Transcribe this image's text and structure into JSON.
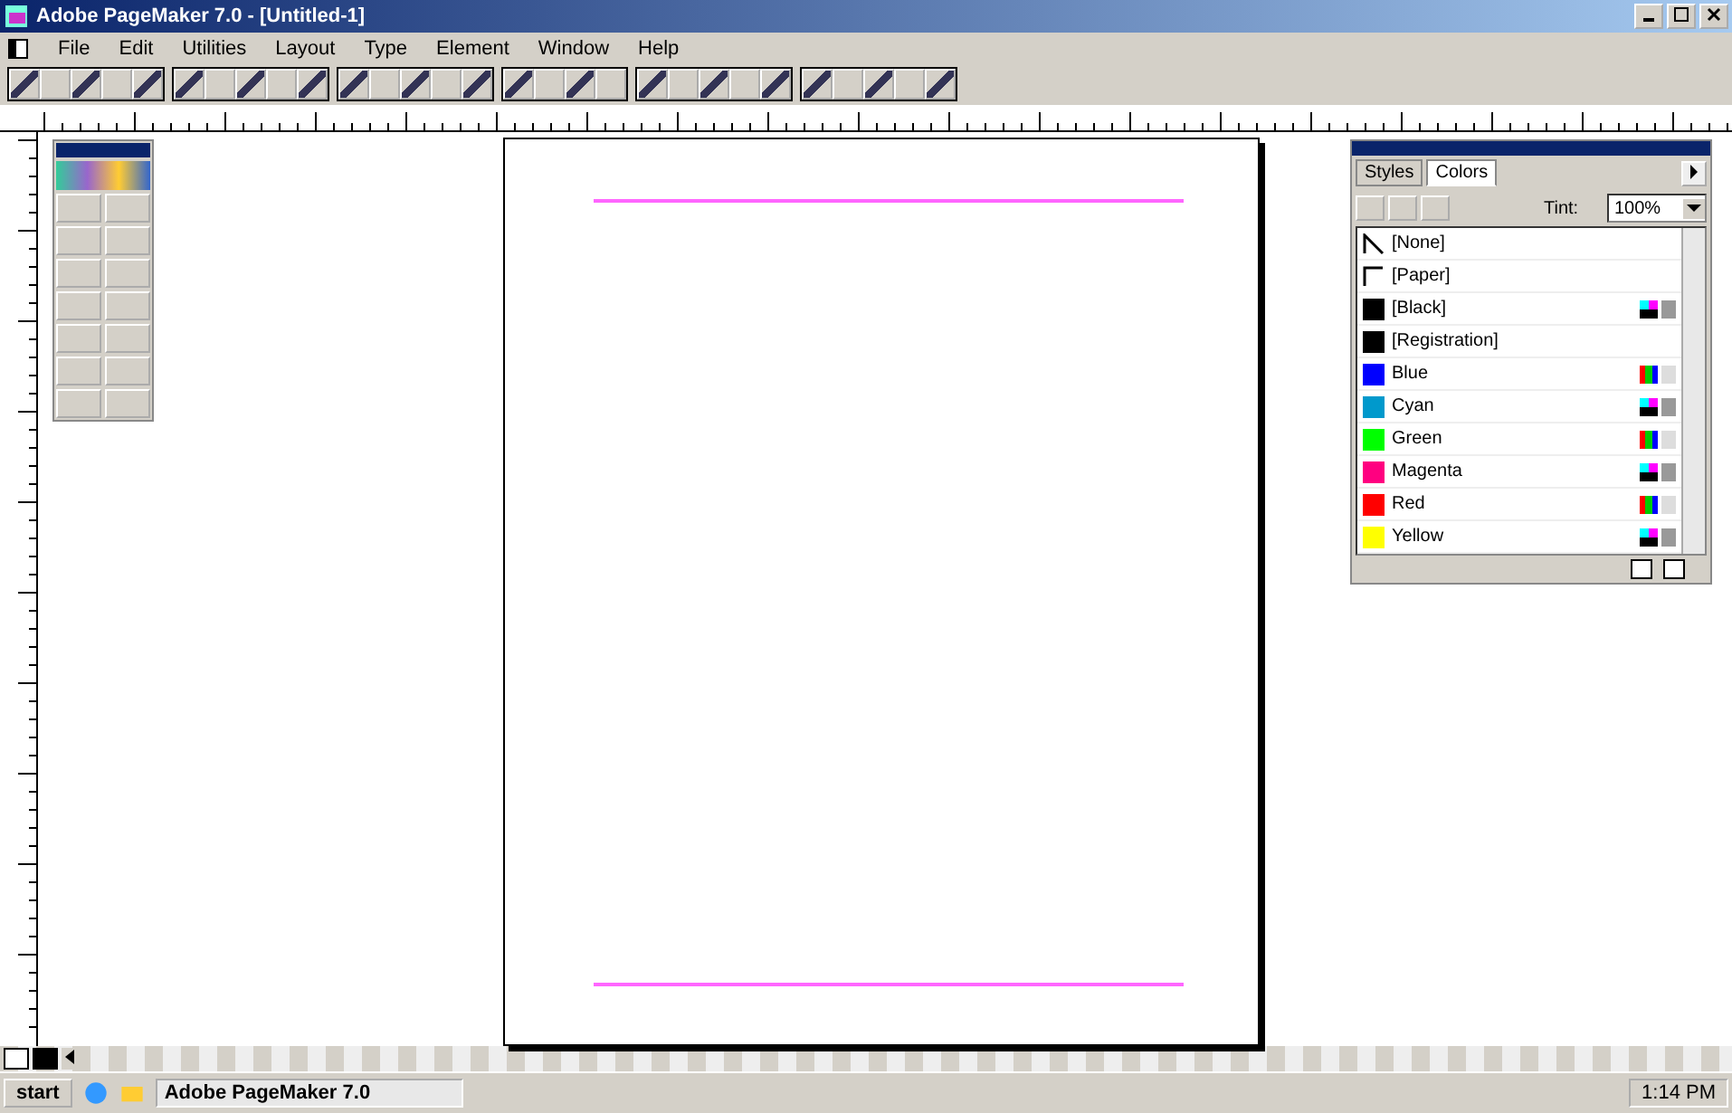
{
  "window": {
    "title": "Adobe PageMaker 7.0 - [Untitled-1]"
  },
  "menu": [
    "File",
    "Edit",
    "Utilities",
    "Layout",
    "Type",
    "Element",
    "Window",
    "Help"
  ],
  "palette": {
    "tabs": [
      {
        "label": "Styles",
        "selected": false
      },
      {
        "label": "Colors",
        "selected": true
      }
    ],
    "tint_label": "Tint:",
    "tint": "100%",
    "colors": [
      {
        "name": "[None]",
        "kind": "none"
      },
      {
        "name": "[Paper]",
        "kind": "paper"
      },
      {
        "name": "[Black]",
        "kind": "cmyk",
        "color": "#000000"
      },
      {
        "name": "[Registration]",
        "kind": "plain",
        "color": "#000000"
      },
      {
        "name": "Blue",
        "kind": "rgb",
        "color": "#0000ff"
      },
      {
        "name": "Cyan",
        "kind": "cmyk",
        "color": "#0099cc"
      },
      {
        "name": "Green",
        "kind": "rgb",
        "color": "#00ff00"
      },
      {
        "name": "Magenta",
        "kind": "cmyk",
        "color": "#ff0080"
      },
      {
        "name": "Red",
        "kind": "rgb",
        "color": "#ff0000"
      },
      {
        "name": "Yellow",
        "kind": "cmyk",
        "color": "#ffff00"
      }
    ]
  },
  "taskbar": {
    "start": "start",
    "tasks": [
      {
        "label": "Adobe PageMaker 7.0",
        "selected": true
      }
    ],
    "clock": "1:14 PM"
  }
}
